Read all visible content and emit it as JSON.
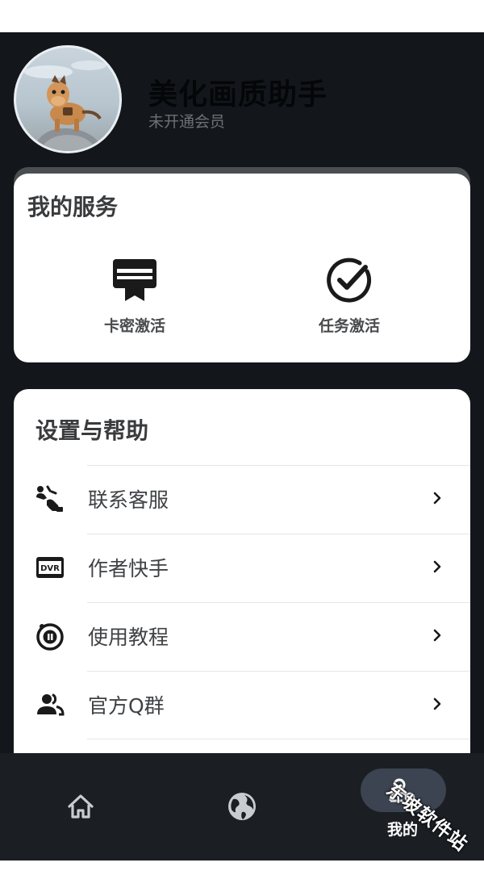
{
  "profile": {
    "app_name": "美化画质助手",
    "member_status": "未开通会员",
    "avatar_icon": "horse-mascot-avatar"
  },
  "services": {
    "title": "我的服务",
    "items": [
      {
        "label": "卡密激活",
        "icon": "card-key-icon"
      },
      {
        "label": "任务激活",
        "icon": "check-circle-icon"
      }
    ]
  },
  "settings": {
    "title": "设置与帮助",
    "items": [
      {
        "label": "联系客服",
        "icon": "contact-support-icon"
      },
      {
        "label": "作者快手",
        "icon": "dvr-icon"
      },
      {
        "label": "使用教程",
        "icon": "tutorial-icon"
      },
      {
        "label": "官方Q群",
        "icon": "group-icon"
      }
    ]
  },
  "bottom_nav": {
    "items": [
      {
        "label": "",
        "icon": "home-icon"
      },
      {
        "label": "",
        "icon": "globe-icon"
      },
      {
        "label": "我的",
        "icon": "profile-icon",
        "active": true
      }
    ]
  },
  "watermark": "东坡软件站",
  "colors": {
    "background": "#13171b",
    "card": "#ffffff",
    "nav_background": "#1b1f24",
    "nav_active_pill": "#3b4450"
  }
}
